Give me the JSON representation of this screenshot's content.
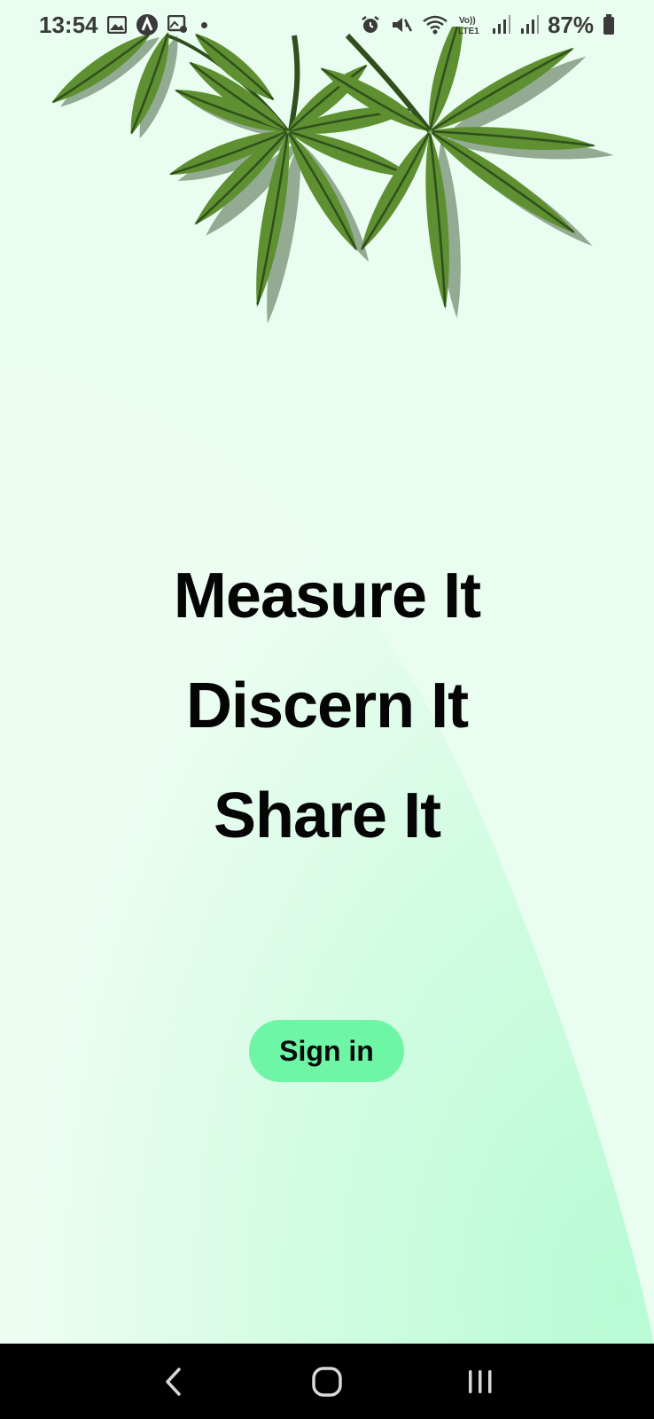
{
  "status_bar": {
    "time": "13:54",
    "battery_percent": "87%",
    "left_icons": [
      "gallery-icon",
      "app-a-icon",
      "image-settings-icon",
      "notification-dot-icon"
    ],
    "right_icons": [
      "alarm-icon",
      "mute-icon",
      "wifi-icon",
      "volte-icon",
      "signal-icon",
      "signal-icon",
      "battery-icon"
    ],
    "volte_label": "Vo)) LTE1"
  },
  "headline": {
    "line1": "Measure It",
    "line2": "Discern It",
    "line3": "Share It"
  },
  "signin": {
    "label": "Sign in"
  },
  "nav_bar": {
    "back": "back-icon",
    "home": "home-icon",
    "recents": "recents-icon"
  },
  "colors": {
    "background": "#e9fdf0",
    "accent_green": "#6ef5a6",
    "curve_green": "#b9fbd6",
    "leaf_green": "#5e8f30",
    "leaf_dark": "#2f4f1c"
  }
}
